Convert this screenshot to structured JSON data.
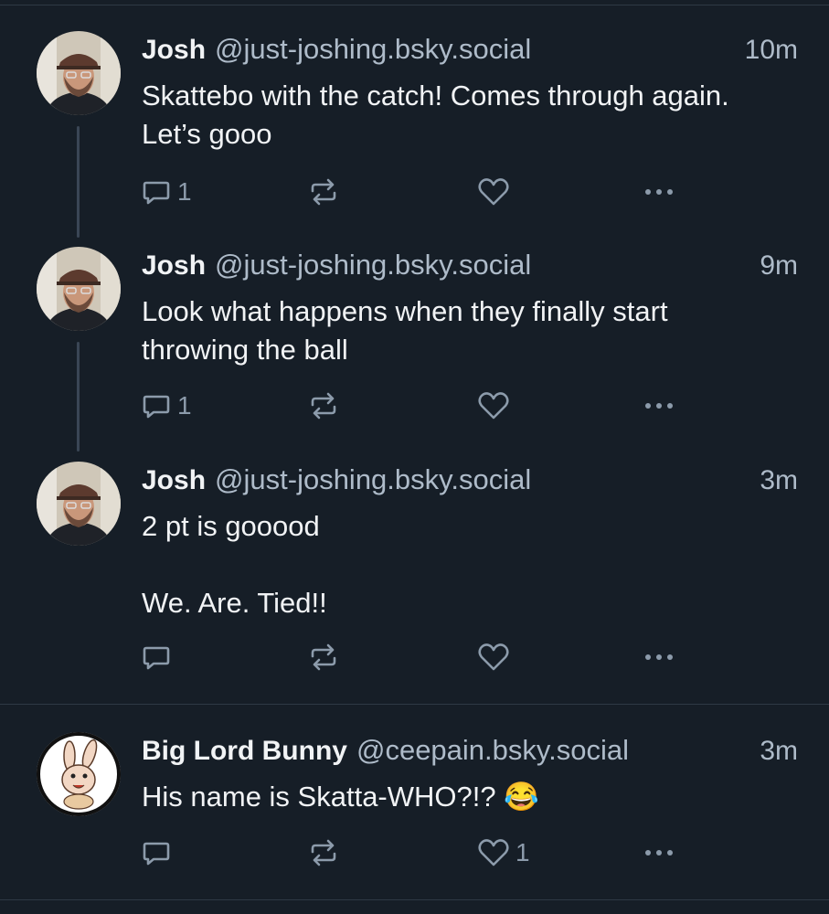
{
  "posts": [
    {
      "name": "Josh",
      "handle": "@just-joshing.bsky.social",
      "time": "10m",
      "text": "Skattebo with the catch! Comes through again. Let’s gooo",
      "reply_count": "1",
      "repost_count": "",
      "like_count": ""
    },
    {
      "name": "Josh",
      "handle": "@just-joshing.bsky.social",
      "time": "9m",
      "text": "Look what happens when they finally start throwing the ball",
      "reply_count": "1",
      "repost_count": "",
      "like_count": ""
    },
    {
      "name": "Josh",
      "handle": "@just-joshing.bsky.social",
      "time": "3m",
      "text": "2 pt is gooood\n\nWe. Are. Tied!!",
      "reply_count": "",
      "repost_count": "",
      "like_count": ""
    },
    {
      "name": "Big Lord Bunny",
      "handle": "@ceepain.bsky.social",
      "time": "3m",
      "text": "His name is Skatta-WHO?!? 😂",
      "reply_count": "",
      "repost_count": "",
      "like_count": "1"
    }
  ],
  "icons": {
    "reply": "reply-icon",
    "repost": "repost-icon",
    "like": "heart-icon",
    "more": "more-options-icon"
  },
  "colors": {
    "background": "#161e27",
    "text": "#f1f3f5",
    "muted": "#aebbc9",
    "icon": "#8c9bab",
    "divider": "#2e3945"
  }
}
